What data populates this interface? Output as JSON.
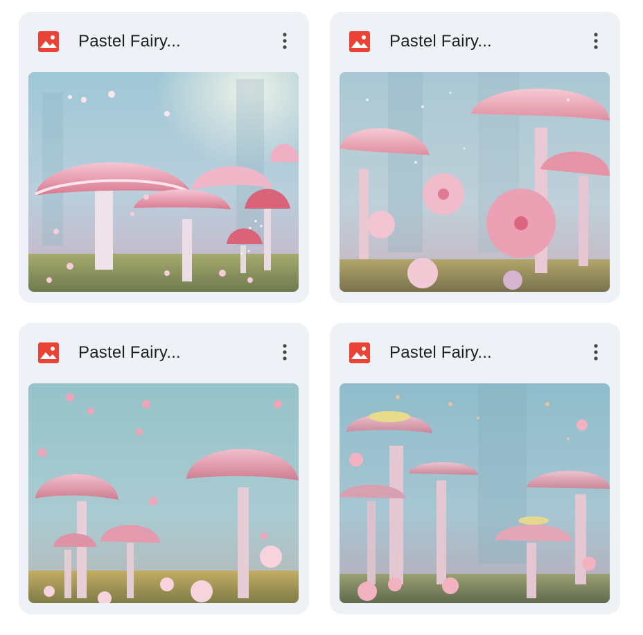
{
  "files": [
    {
      "title": "Pastel Fairy...",
      "icon": "image-file-icon",
      "icon_color": "#ea4335",
      "scene": 1
    },
    {
      "title": "Pastel Fairy...",
      "icon": "image-file-icon",
      "icon_color": "#ea4335",
      "scene": 2
    },
    {
      "title": "Pastel Fairy...",
      "icon": "image-file-icon",
      "icon_color": "#ea4335",
      "scene": 3
    },
    {
      "title": "Pastel Fairy...",
      "icon": "image-file-icon",
      "icon_color": "#ea4335",
      "scene": 4
    }
  ],
  "colors": {
    "card_background": "#eef1f6",
    "title_text": "#1f1f1f",
    "more_icon": "#444746"
  }
}
